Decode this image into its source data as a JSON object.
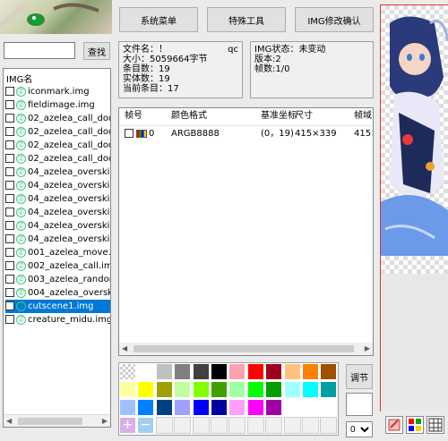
{
  "toolbar": {
    "system_menu": "系统菜单",
    "special_tools": "特殊工具",
    "img_confirm": "IMG修改确认"
  },
  "search": {
    "value": "",
    "button": "查找"
  },
  "list": {
    "header": "IMG名",
    "items": [
      "iconmark.img",
      "fieldimage.img",
      "02_azelea_call_dodg",
      "02_azelea_call_dodg",
      "02_azelea_call_dodg",
      "02_azelea_call_dodg",
      "04_azelea_overskill_",
      "04_azelea_overskill_",
      "04_azelea_overskill_",
      "04_azelea_overskill_",
      "04_azelea_overskill_",
      "04_azelea_overskill_",
      "001_azelea_move.im",
      "002_azelea_call.img",
      "003_azelea_random",
      "004_azelea_overskil",
      "cutscene1.img",
      "creature_midu.img"
    ],
    "selected_index": 16
  },
  "info": {
    "filename": "文件名：！",
    "filename_tail": "qc",
    "size": "大小：5059664字节",
    "entries": "条目数：19",
    "entities": "实体数：19",
    "current": "当前条目：17"
  },
  "img_info": {
    "status": "IMG状态：未变动",
    "version": "版本:2",
    "frames": "帧数:1/0"
  },
  "frame_table": {
    "headers": [
      "帧号",
      "颜色格式",
      "基准坐标",
      "尺寸",
      "帧域"
    ],
    "rows": [
      {
        "frame": "0",
        "format": "ARGB8888",
        "coord": "(0，19)",
        "size": "415×339",
        "domain": "415×"
      }
    ]
  },
  "colors": {
    "palette": [
      "#ffffff",
      "#c0c0c0",
      "#808080",
      "#404040",
      "#000000",
      "#ffa0b0",
      "#ff0000",
      "#a00020",
      "#ffc080",
      "#ff8000",
      "#a05000",
      "#ffffa0",
      "#ffff00",
      "#a0a000",
      "#c0ffa0",
      "#80ff00",
      "#40a000",
      "#a0ffa0",
      "#00ff00",
      "#00a000",
      "#a0ffff",
      "#00ffff",
      "#00a0a0",
      "#a0c0ff",
      "#0080ff",
      "#004080",
      "#a0a0ff",
      "#0000ff",
      "#0000a0",
      "#ffa0ff",
      "#ff00ff",
      "#a000a0"
    ],
    "adjust": "调节",
    "extra_row": [
      "#ff9900",
      "#ffcc00",
      "#ff6600",
      "#ff00cc",
      "#9900ff",
      "#6600cc"
    ]
  },
  "bottom": {
    "zoom": "0"
  }
}
